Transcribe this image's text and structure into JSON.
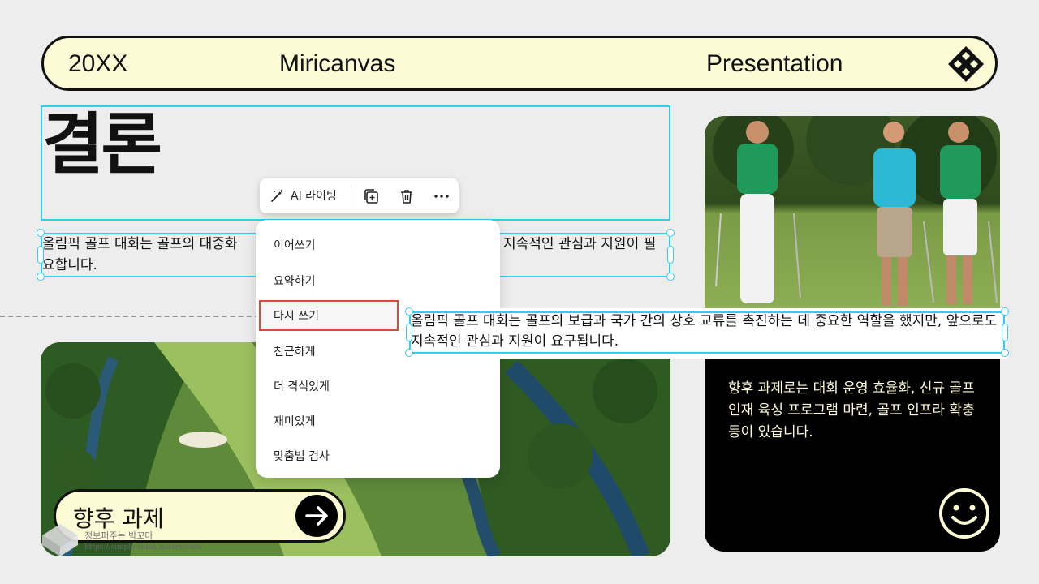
{
  "header": {
    "year": "20XX",
    "brand": "Miricanvas",
    "label": "Presentation",
    "logo_icon": "diamond-grid-icon"
  },
  "slide": {
    "title": "결론",
    "body": "올림픽 골프 대회는 골프의 대중화 … 지속적인 관심과 지원이 필요합니다.",
    "body_left": "올림픽 골프 대회는 골프의 대중화",
    "body_right": "지속적인 관심과 지원이 필",
    "body_line2": "요합니다.",
    "card_text": "향후 과제로는 대회 운영 효율화, 신규 골프 인재 육성 프로그램 마련, 골프 인프라 확충 등이 있습니다.",
    "next_label": "향후 과제",
    "arrow_icon": "arrow-right-icon",
    "smiley_icon": "smiley-icon"
  },
  "toolbar": {
    "ai_label": "AI 라이팅",
    "ai_icon": "magic-wand-icon",
    "duplicate_icon": "duplicate-icon",
    "delete_icon": "trash-icon",
    "more_icon": "more-icon"
  },
  "menu": {
    "items": [
      "이어쓰기",
      "요약하기",
      "다시 쓰기",
      "친근하게",
      "더 격식있게",
      "재미있게",
      "맞춤법 검사"
    ],
    "selected": "다시 쓰기"
  },
  "preview": {
    "text": "올림픽 골프 대회는 골프의 보급과 국가 간의 상호 교류를 촉진하는 데 중요한 역할을 했지만, 앞으로도 지속적인 관심과 지원이 요구됩니다."
  },
  "watermark": {
    "name": "정보퍼주는 박꼬마",
    "url": "https://simple-think.tistory.com/"
  },
  "colors": {
    "accent": "#2fd0ef",
    "cream": "#fdfbd6",
    "highlight": "#d94a3b"
  }
}
